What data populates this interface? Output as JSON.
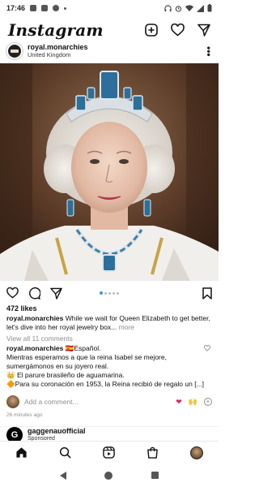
{
  "status_bar": {
    "time": "17:46",
    "icons": [
      "notification-icon",
      "gallery-icon",
      "message-icon",
      "dot-icon",
      "headphones-icon",
      "alarm-icon",
      "wifi-icon",
      "signal-icon",
      "battery-icon"
    ]
  },
  "app": {
    "title": "Instagram",
    "actions": [
      "new-post-icon",
      "activity-heart-icon",
      "direct-message-icon"
    ]
  },
  "post": {
    "username": "royal.monarchies",
    "location": "United Kingdom",
    "likes": "472 likes",
    "caption_user": "royal.monarchies",
    "caption_text": "While we wait for Queen Elizabeth to get better, let's dive into her royal jewelry box...",
    "caption_more": "more",
    "view_all": "View all 11 comments",
    "carousel": {
      "count": 5,
      "active": 1
    },
    "comment": {
      "user": "royal.monarchies",
      "flag": "🇪🇸",
      "text_1": "Español.",
      "text_2": "Mientras esperamos a que la reina Isabel se mejore, sumergámonos en su joyero real.",
      "line_3": "👑 El parure brasileño de aguamarina.",
      "line_4": "🔶Para su coronación en 1953, la Reina recibió de regalo un [...]"
    },
    "add_comment_placeholder": "Add a comment...",
    "quick_reactions": [
      "❤",
      "🙌"
    ],
    "time_ago": "26 minutes ago"
  },
  "next_post": {
    "avatar_letter": "G",
    "username": "gaggenauofficial",
    "sponsored": "Sponsored"
  },
  "bottom_nav": [
    "home-icon",
    "search-icon",
    "reels-icon",
    "shop-icon",
    "profile-avatar"
  ],
  "colors": {
    "accent": "#3897f0",
    "like_red": "#e0245e"
  }
}
